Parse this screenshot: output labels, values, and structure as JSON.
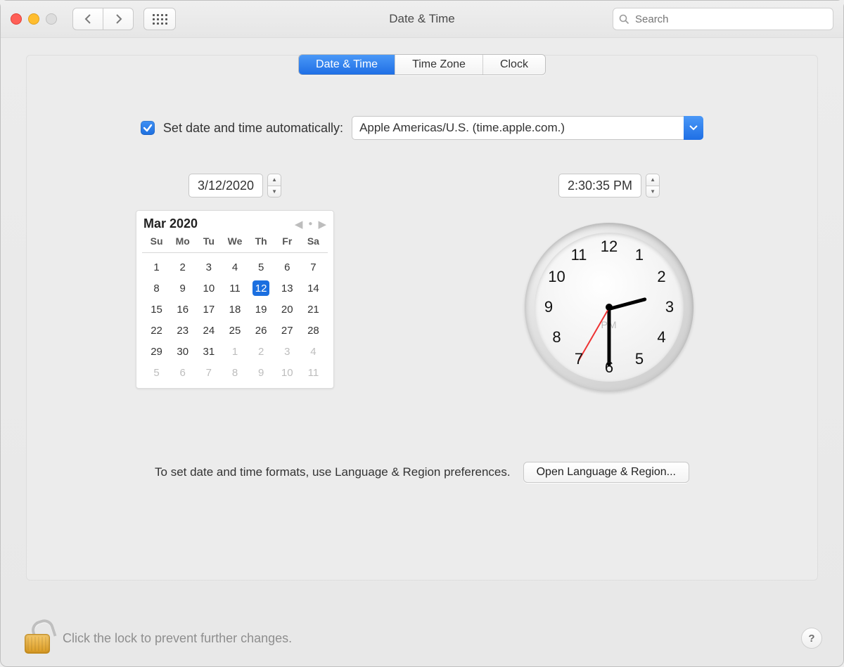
{
  "window": {
    "title": "Date & Time"
  },
  "search": {
    "placeholder": "Search"
  },
  "tabs": [
    "Date & Time",
    "Time Zone",
    "Clock"
  ],
  "active_tab": 0,
  "auto": {
    "checked": true,
    "label": "Set date and time automatically:",
    "server": "Apple Americas/U.S. (time.apple.com.)"
  },
  "date_field": "3/12/2020",
  "time_field": "2:30:35 PM",
  "calendar": {
    "month_label": "Mar 2020",
    "dow": [
      "Su",
      "Mo",
      "Tu",
      "We",
      "Th",
      "Fr",
      "Sa"
    ],
    "weeks": [
      [
        {
          "d": 1
        },
        {
          "d": 2
        },
        {
          "d": 3
        },
        {
          "d": 4
        },
        {
          "d": 5
        },
        {
          "d": 6
        },
        {
          "d": 7
        }
      ],
      [
        {
          "d": 8
        },
        {
          "d": 9
        },
        {
          "d": 10
        },
        {
          "d": 11
        },
        {
          "d": 12,
          "today": true
        },
        {
          "d": 13
        },
        {
          "d": 14
        }
      ],
      [
        {
          "d": 15
        },
        {
          "d": 16
        },
        {
          "d": 17
        },
        {
          "d": 18
        },
        {
          "d": 19
        },
        {
          "d": 20
        },
        {
          "d": 21
        }
      ],
      [
        {
          "d": 22
        },
        {
          "d": 23
        },
        {
          "d": 24
        },
        {
          "d": 25
        },
        {
          "d": 26
        },
        {
          "d": 27
        },
        {
          "d": 28
        }
      ],
      [
        {
          "d": 29
        },
        {
          "d": 30
        },
        {
          "d": 31
        },
        {
          "d": 1,
          "other": true
        },
        {
          "d": 2,
          "other": true
        },
        {
          "d": 3,
          "other": true
        },
        {
          "d": 4,
          "other": true
        }
      ],
      [
        {
          "d": 5,
          "other": true
        },
        {
          "d": 6,
          "other": true
        },
        {
          "d": 7,
          "other": true
        },
        {
          "d": 8,
          "other": true
        },
        {
          "d": 9,
          "other": true
        },
        {
          "d": 10,
          "other": true
        },
        {
          "d": 11,
          "other": true
        }
      ]
    ]
  },
  "clock": {
    "ampm": "PM",
    "hours": 2,
    "minutes": 30,
    "seconds": 35,
    "numbers": [
      "12",
      "1",
      "2",
      "3",
      "4",
      "5",
      "6",
      "7",
      "8",
      "9",
      "10",
      "11"
    ]
  },
  "format_hint": "To set date and time formats, use Language & Region preferences.",
  "open_region_btn": "Open Language & Region...",
  "lock_hint": "Click the lock to prevent further changes.",
  "help": "?"
}
